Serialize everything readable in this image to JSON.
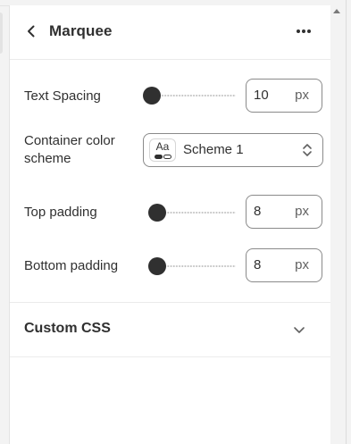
{
  "header": {
    "title": "Marquee",
    "back_icon": "arrow-left-icon",
    "more_icon": "more-horizontal-icon"
  },
  "settings": {
    "text_spacing": {
      "label": "Text Spacing",
      "value": "10",
      "unit": "px",
      "slider_fraction": 0.0
    },
    "container_color_scheme": {
      "label": "Container color scheme",
      "selected": "Scheme 1",
      "swatch_text": "Aa"
    },
    "top_padding": {
      "label": "Top padding",
      "value": "8",
      "unit": "px",
      "slider_fraction": 0.08
    },
    "bottom_padding": {
      "label": "Bottom padding",
      "value": "8",
      "unit": "px",
      "slider_fraction": 0.08
    }
  },
  "custom_css": {
    "label": "Custom CSS",
    "icon": "chevron-down-icon"
  },
  "colors": {
    "text": "#303030",
    "muted_text": "#616161",
    "input_border": "#8a8a8a",
    "slider_thumb": "#303030",
    "panel_background": "#ffffff",
    "page_background": "#f3f3f3"
  }
}
